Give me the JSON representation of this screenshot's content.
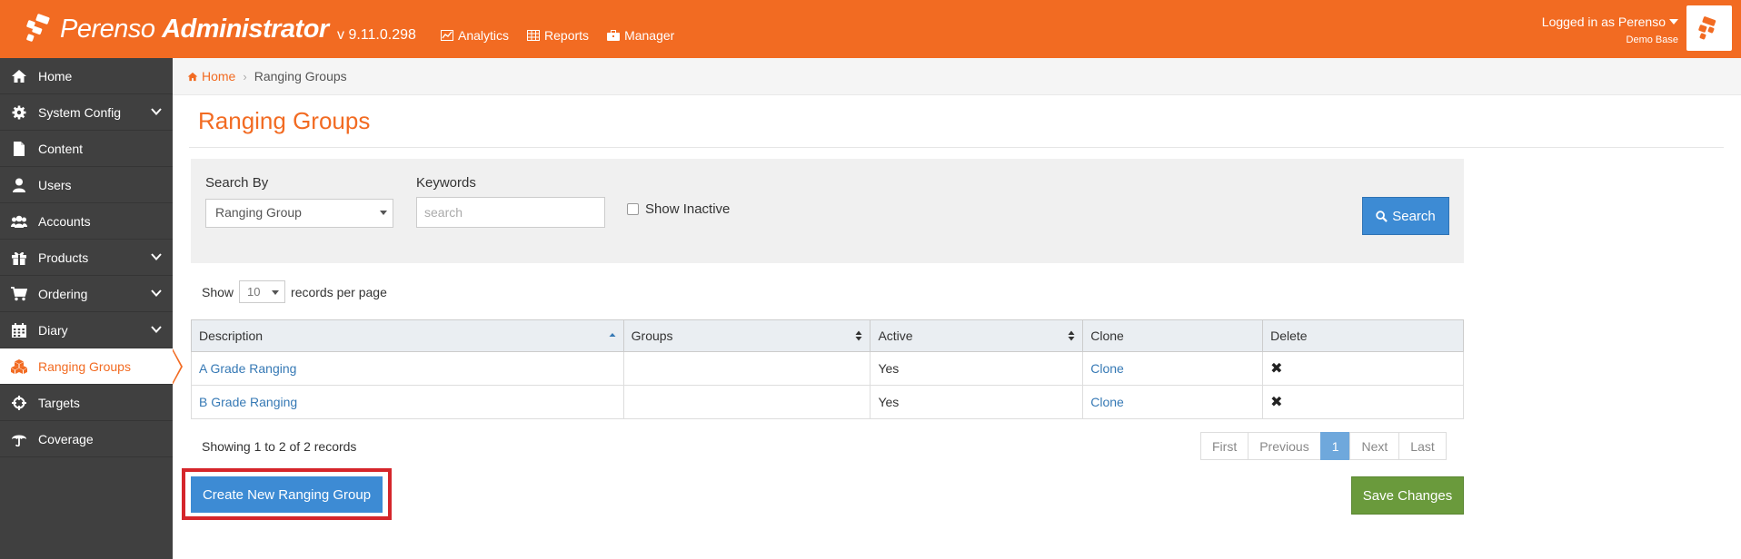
{
  "app": {
    "logo_light": "Perenso",
    "logo_bold": "Administrator",
    "version": "v 9.11.0.298",
    "brand_color": "#f26b22"
  },
  "topnav": [
    {
      "label": "Analytics",
      "icon": "chart-icon"
    },
    {
      "label": "Reports",
      "icon": "table-icon"
    },
    {
      "label": "Manager",
      "icon": "briefcase-icon"
    }
  ],
  "user": {
    "logged_in": "Logged in as Perenso",
    "database": "Demo Base"
  },
  "sidebar": {
    "items": [
      {
        "label": "Home",
        "icon": "home-icon",
        "expandable": false
      },
      {
        "label": "System Config",
        "icon": "gear-icon",
        "expandable": true
      },
      {
        "label": "Content",
        "icon": "file-icon",
        "expandable": false
      },
      {
        "label": "Users",
        "icon": "user-icon",
        "expandable": false
      },
      {
        "label": "Accounts",
        "icon": "users-icon",
        "expandable": false
      },
      {
        "label": "Products",
        "icon": "gift-icon",
        "expandable": true
      },
      {
        "label": "Ordering",
        "icon": "cart-icon",
        "expandable": true
      },
      {
        "label": "Diary",
        "icon": "calendar-icon",
        "expandable": true
      },
      {
        "label": "Ranging Groups",
        "icon": "cubes-icon",
        "expandable": false,
        "active": true
      },
      {
        "label": "Targets",
        "icon": "crosshairs-icon",
        "expandable": false
      },
      {
        "label": "Coverage",
        "icon": "umbrella-icon",
        "expandable": false
      }
    ]
  },
  "breadcrumb": {
    "home": "Home",
    "current": "Ranging Groups"
  },
  "page": {
    "title": "Ranging Groups"
  },
  "search": {
    "search_by_label": "Search By",
    "search_by_value": "Ranging Group",
    "keywords_label": "Keywords",
    "keywords_placeholder": "search",
    "keywords_value": "",
    "show_inactive_label": "Show Inactive",
    "show_inactive_checked": false,
    "button_label": "Search"
  },
  "paging": {
    "show_label": "Show",
    "per_page_value": "10",
    "per_page_suffix": "records per page",
    "summary": "Showing 1 to 2 of 2 records",
    "first": "First",
    "previous": "Previous",
    "current_page": "1",
    "next": "Next",
    "last": "Last"
  },
  "table": {
    "headers": [
      "Description",
      "Groups",
      "Active",
      "Clone",
      "Delete"
    ],
    "rows": [
      {
        "description": "A Grade Ranging",
        "groups": "",
        "active": "Yes",
        "clone": "Clone",
        "delete": "✖"
      },
      {
        "description": "B Grade Ranging",
        "groups": "",
        "active": "Yes",
        "clone": "Clone",
        "delete": "✖"
      }
    ]
  },
  "actions": {
    "create_label": "Create New Ranging Group",
    "save_label": "Save Changes",
    "highlight_color": "#d5262b"
  }
}
